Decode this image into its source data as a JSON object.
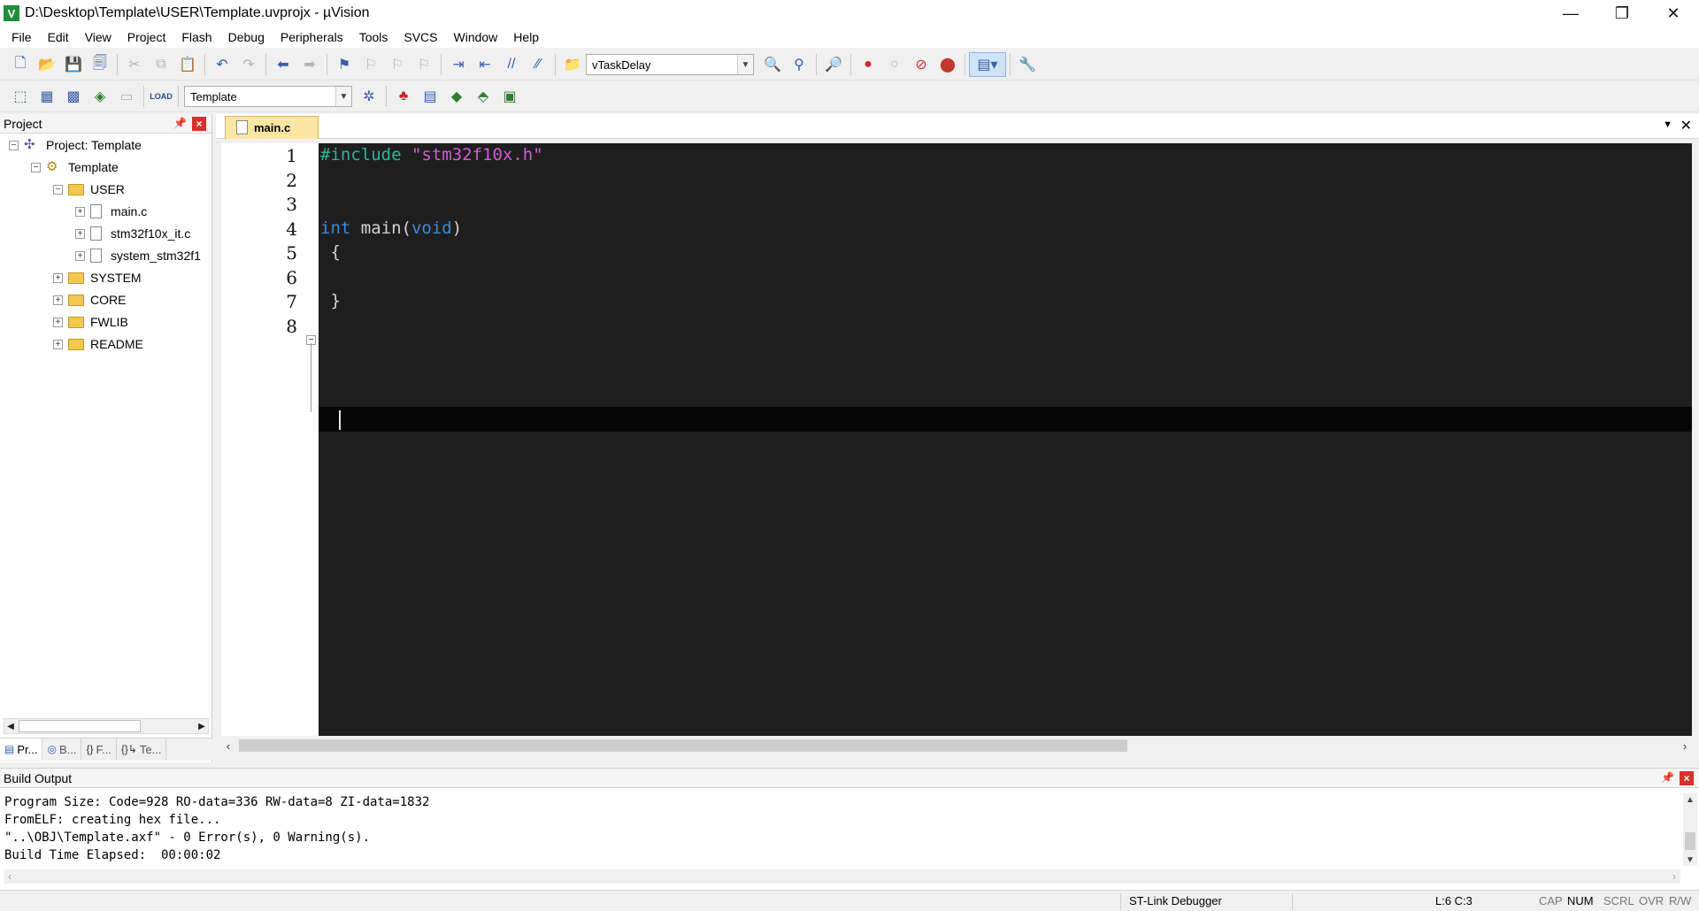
{
  "window": {
    "title": "D:\\Desktop\\Template\\USER\\Template.uvprojx - µVision",
    "minimize": "—",
    "restore": "❐",
    "close": "✕"
  },
  "menu": [
    "File",
    "Edit",
    "View",
    "Project",
    "Flash",
    "Debug",
    "Peripherals",
    "Tools",
    "SVCS",
    "Window",
    "Help"
  ],
  "toolbar1": {
    "find_combo_value": "vTaskDelay"
  },
  "toolbar2": {
    "target_combo_value": "Template",
    "load_label": "LOAD"
  },
  "project_panel": {
    "title": "Project",
    "tree": {
      "root": "Project: Template",
      "target": "Template",
      "user_folder": "USER",
      "files": [
        "main.c",
        "stm32f10x_it.c",
        "system_stm32f1"
      ],
      "folders": [
        "SYSTEM",
        "CORE",
        "FWLIB",
        "README"
      ]
    },
    "tabs": [
      "Pr...",
      "B...",
      "F...",
      "Te..."
    ]
  },
  "editor": {
    "active_tab": "main.c",
    "line_numbers": [
      "1",
      "2",
      "3",
      "4",
      "5",
      "6",
      "7",
      "8"
    ],
    "code": {
      "l1_directive": "#include",
      "l1_string": "\"stm32f10x.h\"",
      "l4_type": "int",
      "l4_name": " main(",
      "l4_param": "void",
      "l4_close": ")",
      "l5": " {",
      "l7": " }"
    }
  },
  "build_output": {
    "title": "Build Output",
    "lines": [
      "Program Size: Code=928 RO-data=336 RW-data=8 ZI-data=1832",
      "FromELF: creating hex file...",
      "\"..\\OBJ\\Template.axf\" - 0 Error(s), 0 Warning(s).",
      "Build Time Elapsed:  00:00:02"
    ]
  },
  "status": {
    "debugger": "ST-Link Debugger",
    "position": "L:6 C:3",
    "cap": "CAP",
    "num": "NUM",
    "scrl": "SCRL",
    "ovr": "OVR",
    "rw": "R/W"
  }
}
